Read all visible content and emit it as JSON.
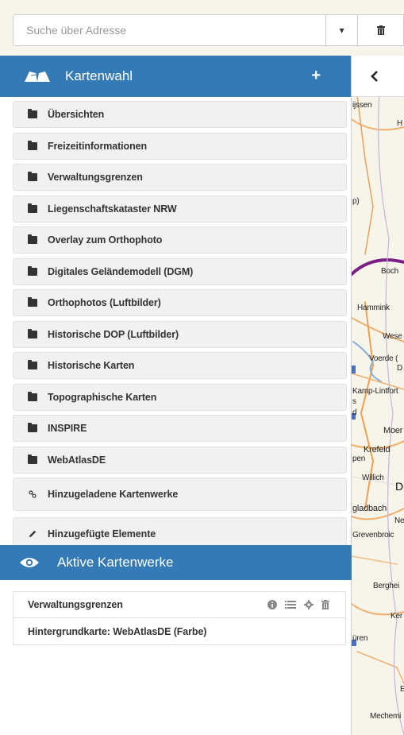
{
  "search": {
    "placeholder": "Suche über Adresse",
    "dropdown_icon": "caret-down-icon",
    "clear_icon": "trash-icon"
  },
  "kartenwahl": {
    "title": "Kartenwahl",
    "add_label": "+",
    "items": [
      {
        "label": "Übersichten",
        "icon": "folder-icon"
      },
      {
        "label": "Freizeitinformationen",
        "icon": "folder-icon"
      },
      {
        "label": "Verwaltungsgrenzen",
        "icon": "folder-icon"
      },
      {
        "label": "Liegenschaftskataster NRW",
        "icon": "folder-icon"
      },
      {
        "label": "Overlay zum Orthophoto",
        "icon": "folder-icon"
      },
      {
        "label": "Digitales Geländemodell (DGM)",
        "icon": "folder-icon"
      },
      {
        "label": "Orthophotos (Luftbilder)",
        "icon": "folder-icon"
      },
      {
        "label": "Historische DOP (Luftbilder)",
        "icon": "folder-icon"
      },
      {
        "label": "Historische Karten",
        "icon": "folder-icon"
      },
      {
        "label": "Topographische Karten",
        "icon": "folder-icon"
      },
      {
        "label": "INSPIRE",
        "icon": "folder-icon"
      },
      {
        "label": "WebAtlasDE",
        "icon": "folder-icon"
      },
      {
        "label": "Hinzugeladene Kartenwerke",
        "icon": "link-icon"
      },
      {
        "label": "Hinzugefügte Elemente",
        "icon": "pencil-icon"
      }
    ]
  },
  "aktive": {
    "title": "Aktive Kartenwerke",
    "items": [
      {
        "label": "Verwaltungsgrenzen"
      },
      {
        "label": "Hintergrundkarte: WebAtlasDE (Farbe)"
      }
    ]
  },
  "map": {
    "labels": [
      "ijssen",
      "H",
      "p)",
      "Boch",
      "Hammink",
      "Wese",
      "Voerde (",
      "D",
      "Kamp-Lintfort",
      "s",
      "d",
      "Moer",
      "Krefeld",
      "pen",
      "Willich",
      "D",
      "gladbach",
      "Ne",
      "Grevenbroic",
      "Berghei",
      "Ker",
      "üren",
      "E",
      "Mechemi"
    ]
  }
}
